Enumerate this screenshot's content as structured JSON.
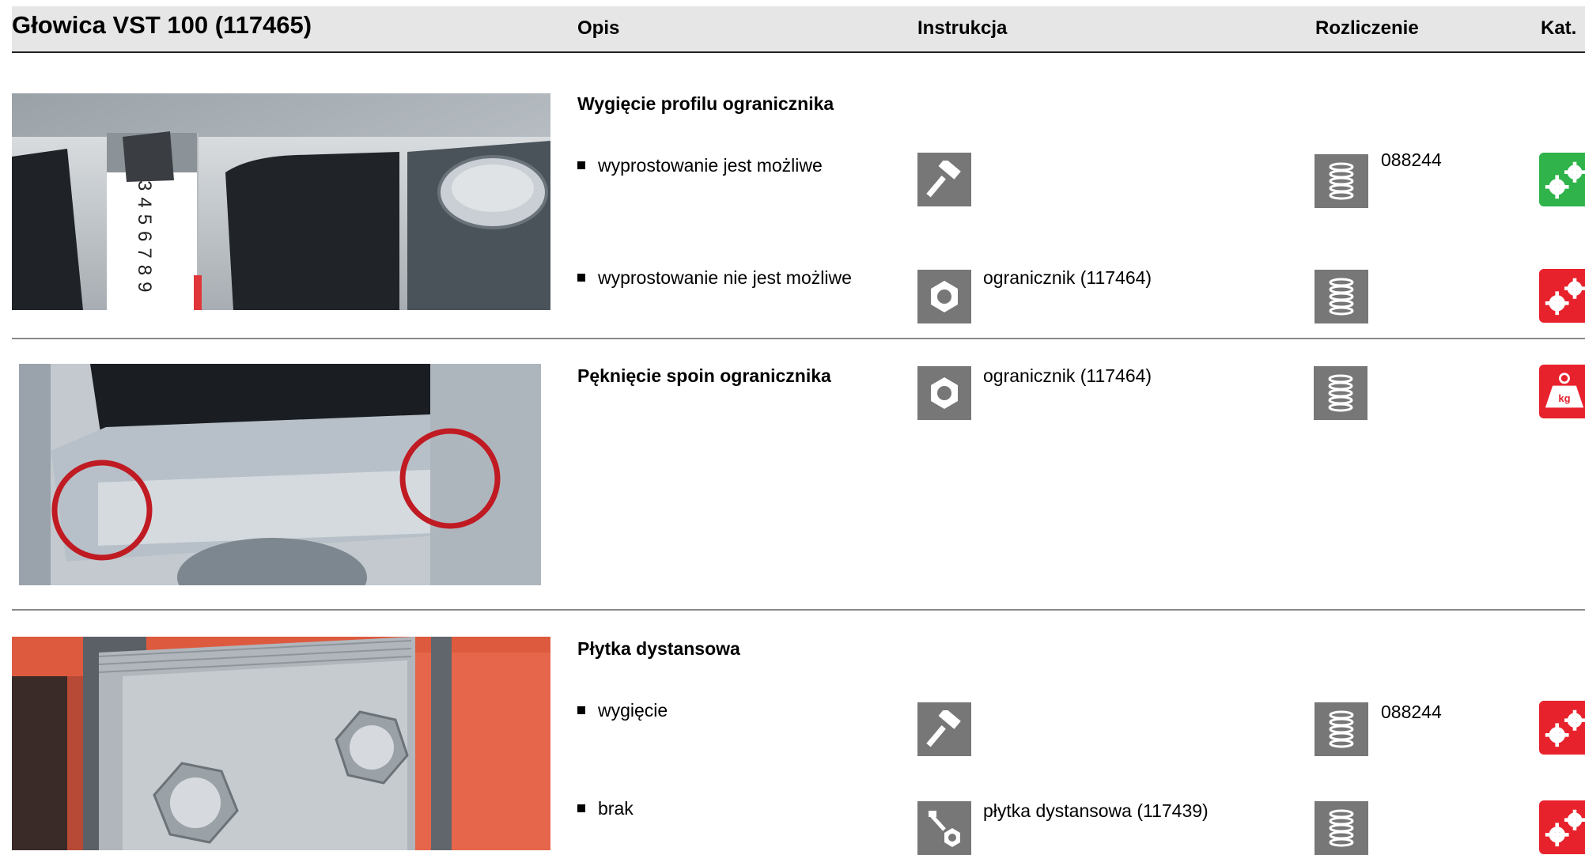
{
  "header": {
    "title": "Głowica VST 100 (117465)",
    "columns": {
      "opis": "Opis",
      "instrukcja": "Instrukcja",
      "rozliczenie": "Rozliczenie",
      "kat": "Kat."
    }
  },
  "sections": [
    {
      "title": "Wygięcie profilu ogranicznika",
      "rows": [
        {
          "bullet": "wyprostowanie jest możliwe",
          "instr_icon": "hammer-icon",
          "instr_text": "",
          "billing_icon": "coil-spring-icon",
          "billing_text": "088244",
          "kat_icon": "gears-icon",
          "kat_color": "#2fb34a"
        },
        {
          "bullet": "wyprostowanie nie jest możliwe",
          "instr_icon": "nut-icon",
          "instr_text": "ogranicznik (117464)",
          "billing_icon": "coil-spring-icon",
          "billing_text": "",
          "kat_icon": "gears-icon",
          "kat_color": "#e8222c"
        }
      ]
    },
    {
      "title": "Pęknięcie spoin ogranicznika",
      "rows": [
        {
          "bullet": "",
          "instr_icon": "nut-icon",
          "instr_text": "ogranicznik (117464)",
          "billing_icon": "coil-spring-icon",
          "billing_text": "",
          "kat_icon": "weight-kg-icon",
          "kat_color": "#e8222c",
          "kat_label": "kg"
        }
      ]
    },
    {
      "title": "Płytka dystansowa",
      "rows": [
        {
          "bullet": "wygięcie",
          "instr_icon": "hammer-icon",
          "instr_text": "",
          "billing_icon": "coil-spring-icon",
          "billing_text": "088244",
          "kat_icon": "gears-icon",
          "kat_color": "#e8222c"
        },
        {
          "bullet": "brak",
          "instr_icon": "bolt-nut-icon",
          "instr_text": "płytka dystansowa (117439)",
          "billing_icon": "coil-spring-icon",
          "billing_text": "",
          "kat_icon": "gears-icon",
          "kat_color": "#e8222c"
        }
      ]
    }
  ],
  "photo_annotations": {
    "tape_measure_digits": "3456789"
  }
}
